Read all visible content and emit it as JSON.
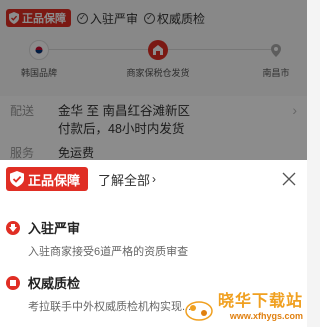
{
  "guarantee": {
    "badge_label": "正品保障",
    "items": [
      "入驻严审",
      "权威质检"
    ]
  },
  "route": {
    "origin": "韩国品牌",
    "hub": "商家保税仓发货",
    "destination": "南昌市"
  },
  "delivery": {
    "label": "配送",
    "line1": "金华 至 南昌红谷滩新区",
    "line2": "付款后，48小时内发货"
  },
  "service": {
    "label": "服务",
    "text": "免运费"
  },
  "sheet": {
    "badge_label": "正品保障",
    "learn_more": "了解全部",
    "features": [
      {
        "title": "入驻严审",
        "desc": "入驻商家接受6道严格的资质审查"
      },
      {
        "title": "权威质检",
        "desc": "考拉联手中外权威质检机构实现..."
      }
    ]
  },
  "watermark": {
    "title": "晓华下载站",
    "url": "www.xfhygs.com"
  },
  "colors": {
    "brand_red": "#e02e24",
    "watermark_orange": "#f0a020"
  }
}
